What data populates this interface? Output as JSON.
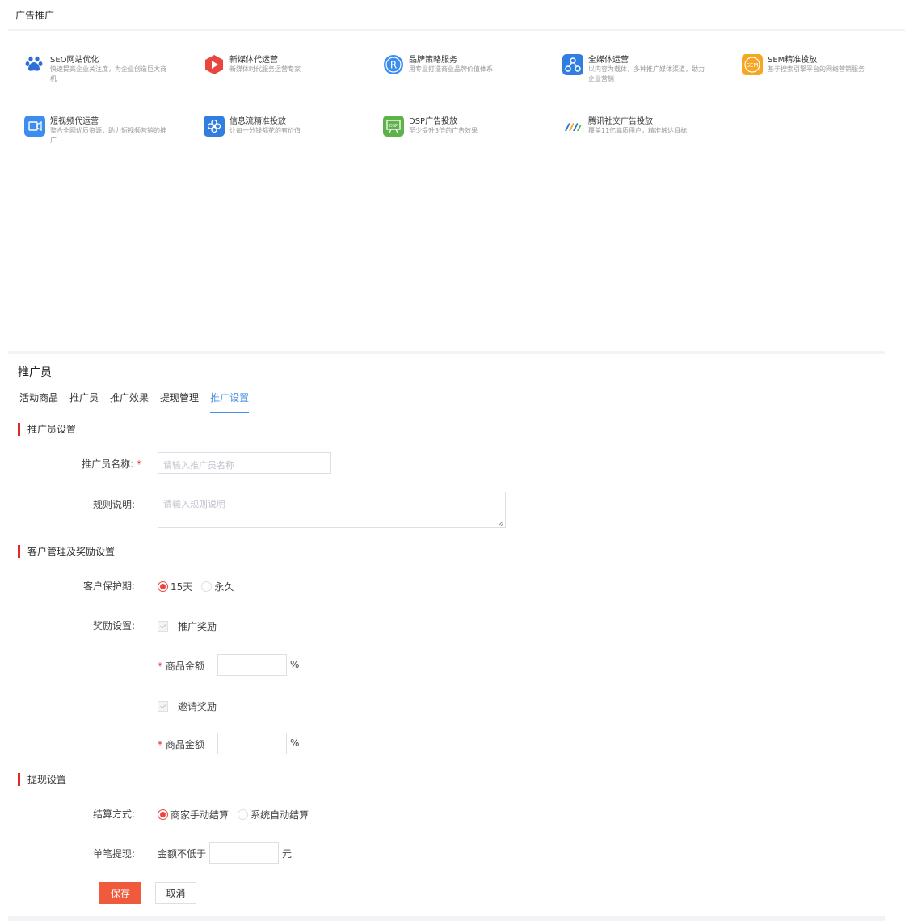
{
  "header": {
    "title": "广告推广"
  },
  "services": [
    {
      "icon": "paw-icon",
      "title": "SEO网站优化",
      "desc": "快速提高企业关注度，为企业创造巨大商机"
    },
    {
      "icon": "play-icon",
      "title": "新媒体代运营",
      "desc": "新媒体时代服务运营专家"
    },
    {
      "icon": "registered-icon",
      "title": "品牌策略服务",
      "desc": "用专业打造商业品牌价值体系"
    },
    {
      "icon": "share-nodes-icon",
      "title": "全媒体运营",
      "desc": "以内容为载体，多种推广媒体渠道，助力企业营销"
    },
    {
      "icon": "sem-icon",
      "title": "SEM精准投放",
      "desc": "基于搜索引擎平台的网络营销服务"
    },
    {
      "icon": "video-icon",
      "title": "短视频代运营",
      "desc": "整合全网优质资源，助力短视频营销的推广"
    },
    {
      "icon": "flower-icon",
      "title": "信息流精准投放",
      "desc": "让每一分钱都花的有价值"
    },
    {
      "icon": "presentation-icon",
      "title": "DSP广告投放",
      "desc": "至少提升3倍的广告效果"
    },
    {
      "icon": "tencent-ad-icon",
      "title": "腾讯社交广告投放",
      "desc": "覆盖11亿高质用户，精准触达目标"
    }
  ],
  "promoter": {
    "title": "推广员",
    "tabs": [
      "活动商品",
      "推广员",
      "推广效果",
      "提现管理",
      "推广设置"
    ],
    "active_tab": "推广设置"
  },
  "form": {
    "section1": "推广员设置",
    "name_label": "推广员名称:",
    "required_mark": "*",
    "name_placeholder": "请输入推广员名称",
    "rule_label": "规则说明:",
    "rule_placeholder": "请输入规则说明",
    "section2": "客户管理及奖励设置",
    "protect_label": "客户保护期:",
    "protect_options": [
      "15天",
      "永久"
    ],
    "protect_selected": "15天",
    "reward_label": "奖励设置:",
    "promo_reward": "推广奖励",
    "invite_reward": "邀请奖励",
    "amount_label": "商品金额",
    "percent": "%",
    "section3": "提现设置",
    "settle_label": "结算方式:",
    "settle_options": [
      "商家手动结算",
      "系统自动结算"
    ],
    "settle_selected": "商家手动结算",
    "single_label": "单笔提现:",
    "min_amount": "金额不低于",
    "yuan": "元",
    "save": "保存",
    "cancel": "取消"
  },
  "colors": {
    "accent": "#e8463f",
    "tab_active": "#4a90e2",
    "save_button": "#f05a3c"
  }
}
